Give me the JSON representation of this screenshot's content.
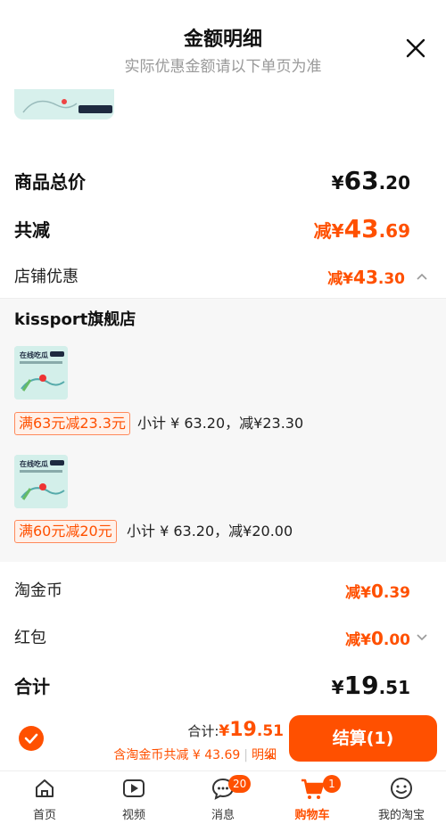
{
  "header": {
    "title": "金额明细",
    "subtitle": "实际优惠金额请以下单页为准"
  },
  "summary": {
    "total_label": "商品总价",
    "total_price": {
      "yen": "¥",
      "int": "63",
      "dec": ".20"
    },
    "discount_label": "共减",
    "discount_price": {
      "prefix": "减¥",
      "int": "43",
      "dec": ".69"
    },
    "shop_discount_label": "店铺优惠",
    "shop_discount_price": {
      "prefix": "减¥",
      "int": "43",
      "dec": ".30"
    }
  },
  "shop": {
    "name": "kissport旗舰店",
    "items": [
      {
        "tag": "满63元减23.3元",
        "subtotal": "小计 ¥ 63.20，减¥23.30"
      },
      {
        "tag": "满60元减20元",
        "subtotal": "小计 ¥ 63.20，减¥20.00"
      }
    ],
    "product_image_text": {
      "line1": "在线吃瓜"
    }
  },
  "more": {
    "coins_label": "淘金币",
    "coins_price": {
      "prefix": "减¥",
      "int": "0",
      "dec": ".39"
    },
    "redpacket_label": "红包",
    "redpacket_price": {
      "prefix": "减¥",
      "int": "0",
      "dec": ".00"
    },
    "sum_label": "合计",
    "sum_price": {
      "yen": "¥",
      "int": "19",
      "dec": ".51"
    }
  },
  "bottom": {
    "total_prefix": "合计:",
    "total_yen": "¥",
    "total_int": "19",
    "total_dec": ".51",
    "coin_note": "含淘金币共减 ¥ 43.69",
    "detail_label": "明细",
    "checkout_label": "结算(1)"
  },
  "tabs": [
    {
      "label": "首页",
      "icon": "home-icon"
    },
    {
      "label": "视频",
      "icon": "video-icon"
    },
    {
      "label": "消息",
      "icon": "message-icon",
      "badge": "20"
    },
    {
      "label": "购物车",
      "icon": "cart-icon",
      "badge": "1",
      "active": true
    },
    {
      "label": "我的淘宝",
      "icon": "profile-icon"
    }
  ],
  "colors": {
    "accent": "#ff5000",
    "muted": "#999999",
    "panel": "#f7f7f7"
  }
}
